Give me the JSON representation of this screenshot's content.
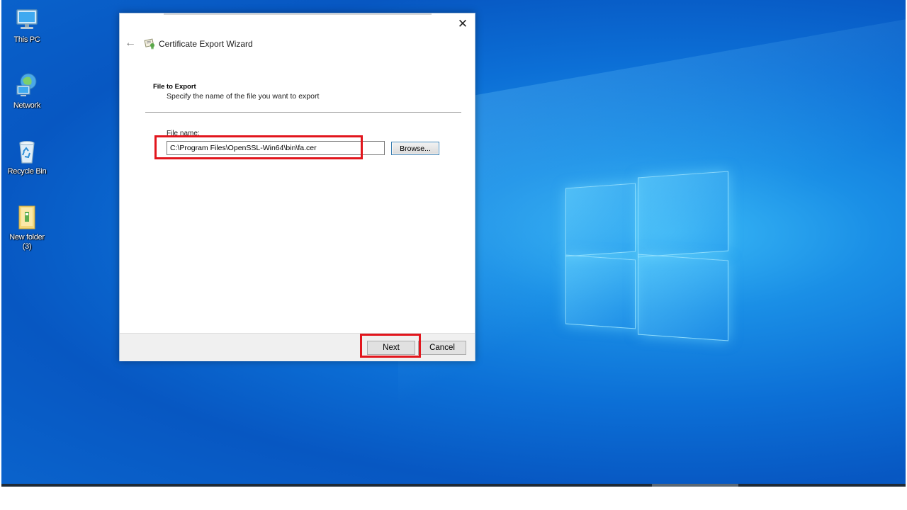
{
  "desktop": {
    "icons": [
      {
        "label": "This PC",
        "icon": "this-pc-icon"
      },
      {
        "label": "Network",
        "icon": "network-icon"
      },
      {
        "label": "Recycle Bin",
        "icon": "recycle-bin-icon"
      },
      {
        "label": "New folder (3)",
        "icon": "folder-icon"
      }
    ],
    "colors": {
      "accent": "#0c6fd6",
      "highlight": "#e2161d"
    }
  },
  "wizard": {
    "title": "Certificate Export Wizard",
    "close_glyph": "✕",
    "back_glyph": "←",
    "section_title": "File to Export",
    "section_subtitle": "Specify the name of the file you want to export",
    "file_label": "File name:",
    "file_value": "C:\\Program Files\\OpenSSL-Win64\\bin\\fa.cer",
    "browse_label": "Browse...",
    "next_label": "Next",
    "cancel_label": "Cancel"
  }
}
